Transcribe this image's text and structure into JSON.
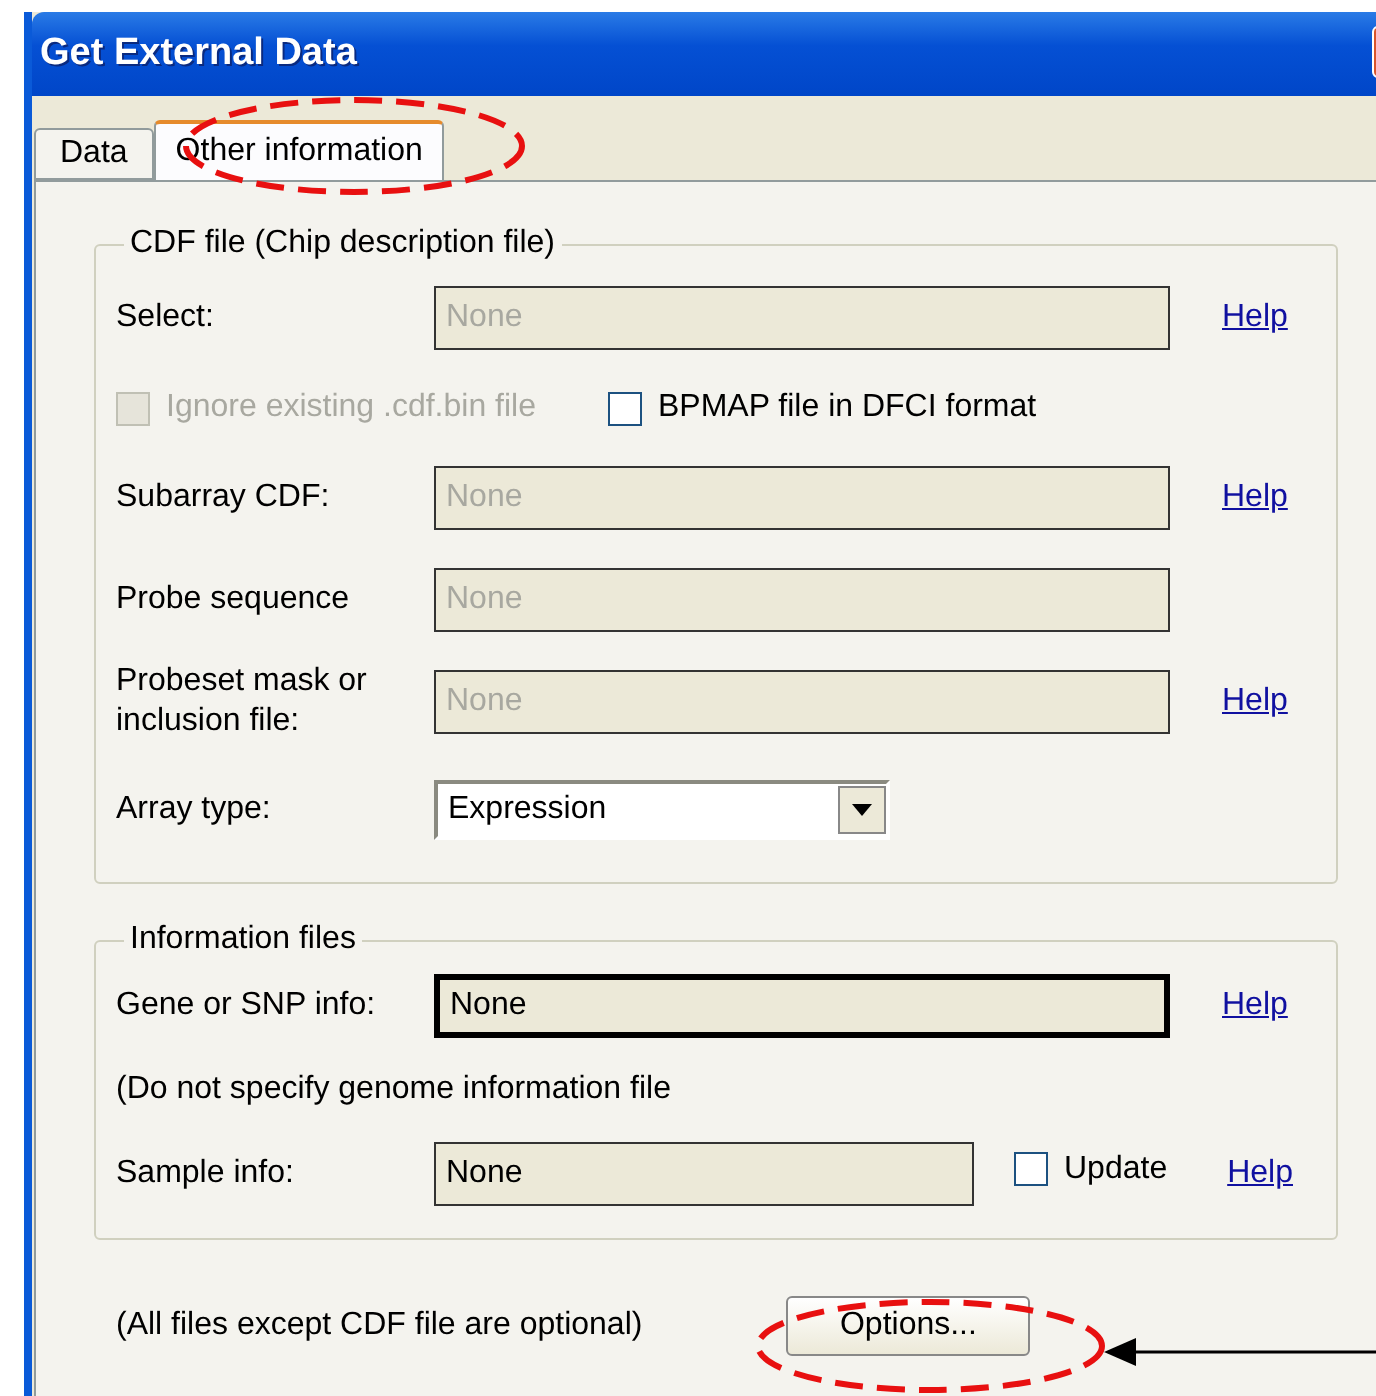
{
  "window": {
    "title": "Get External Data"
  },
  "tabs": [
    {
      "label": "Data",
      "selected": false
    },
    {
      "label": "Other information",
      "selected": true
    }
  ],
  "cdf_group": {
    "title": "CDF file (Chip description file)",
    "rows": [
      {
        "kind": "field",
        "label": "Select:",
        "value": "None",
        "disabled": true,
        "help": "Help"
      },
      {
        "kind": "checkboxes",
        "items": [
          {
            "label": "Ignore existing .cdf.bin file",
            "checked": false,
            "disabled": true
          },
          {
            "label": "BPMAP file in DFCI format",
            "checked": false,
            "disabled": false
          }
        ]
      },
      {
        "kind": "field",
        "label": "Subarray CDF:",
        "value": "None",
        "disabled": true,
        "help": "Help"
      },
      {
        "kind": "field",
        "label": "Probe sequence",
        "value": "None",
        "disabled": true
      },
      {
        "kind": "field",
        "label": "Probeset mask or inclusion file:",
        "value": "None",
        "disabled": true,
        "help": "Help"
      },
      {
        "kind": "dropdown",
        "label": "Array type:",
        "value": "Expression"
      }
    ]
  },
  "info_group": {
    "title": "Information files",
    "rows": [
      {
        "kind": "field",
        "label": "Gene or SNP info:",
        "value": "None",
        "disabled": false,
        "focused": true,
        "help": "Help"
      },
      {
        "kind": "note",
        "text": "(Do not specify genome information file"
      },
      {
        "kind": "field",
        "label": "Sample info:",
        "value": "None",
        "disabled": false,
        "checkbox": {
          "label": "Update",
          "checked": false
        },
        "help": "Help"
      }
    ]
  },
  "footer": {
    "note": "(All files except CDF file are optional)",
    "button": "Options..."
  }
}
